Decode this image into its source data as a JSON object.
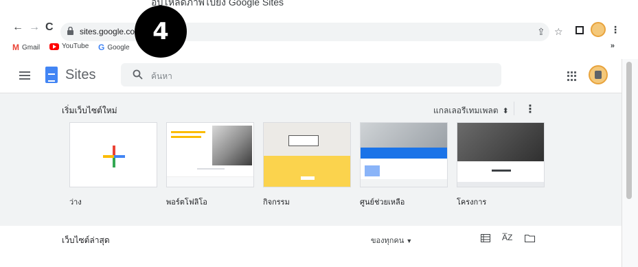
{
  "instructions_top": "อัปโหลดภาพไปยัง Google Sites",
  "browser": {
    "url": "sites.google.com/",
    "bookmarks": [
      {
        "icon": "gmail-icon",
        "label": "Gmail"
      },
      {
        "icon": "youtube-icon",
        "label": "YouTube"
      },
      {
        "icon": "google-icon",
        "label": "Google"
      }
    ],
    "overflow": "»"
  },
  "step_badge": "4",
  "app": {
    "title": "Sites",
    "search_placeholder": "ค้นหา"
  },
  "templates": {
    "heading": "เริ่มเว็บไซต์ใหม่",
    "gallery_label": "แกลเลอรีเทมเพลต",
    "items": [
      {
        "label": "ว่าง"
      },
      {
        "label": "พอร์ตโฟลิโอ"
      },
      {
        "label": "กิจกรรม"
      },
      {
        "label": "ศูนย์ช่วยเหลือ"
      },
      {
        "label": "โครงการ"
      }
    ]
  },
  "recent": {
    "title": "เว็บไซต์ล่าสุด",
    "owner_filter": "ของทุกคน"
  },
  "colors": {
    "google_blue": "#4285f4",
    "google_red": "#ea4335",
    "google_yellow": "#fbbc04",
    "google_green": "#34a853",
    "panel_bg": "#f1f3f4"
  }
}
